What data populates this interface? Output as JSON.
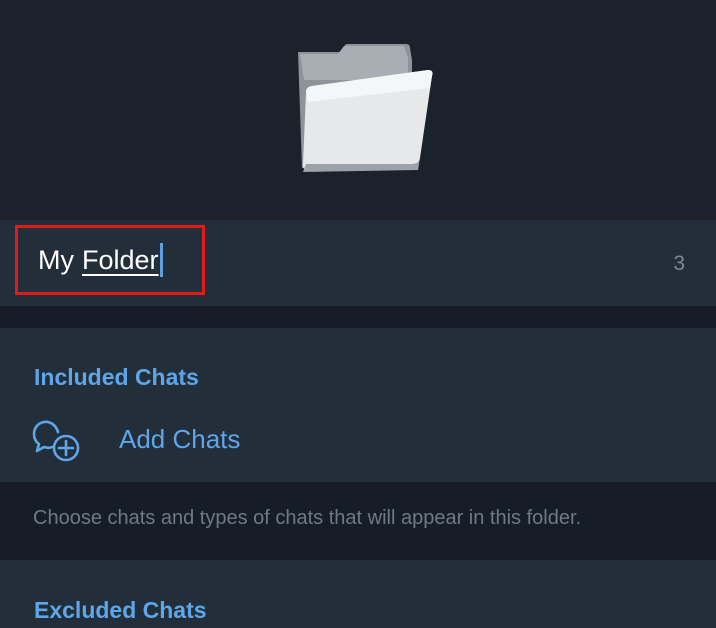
{
  "folder_name": {
    "prefix": "My",
    "highlighted": "Folder",
    "char_count": "3"
  },
  "included": {
    "title": "Included Chats",
    "add_label": "Add Chats",
    "hint": "Choose chats and types of chats that will appear in this folder."
  },
  "excluded": {
    "title": "Excluded Chats"
  },
  "icons": {
    "folder": "folder-icon",
    "add_chat": "add-chat-icon"
  },
  "colors": {
    "accent": "#5fa6e8",
    "highlight_border": "#e01b1b",
    "background": "#1b222c",
    "section_background": "#232e3b"
  }
}
